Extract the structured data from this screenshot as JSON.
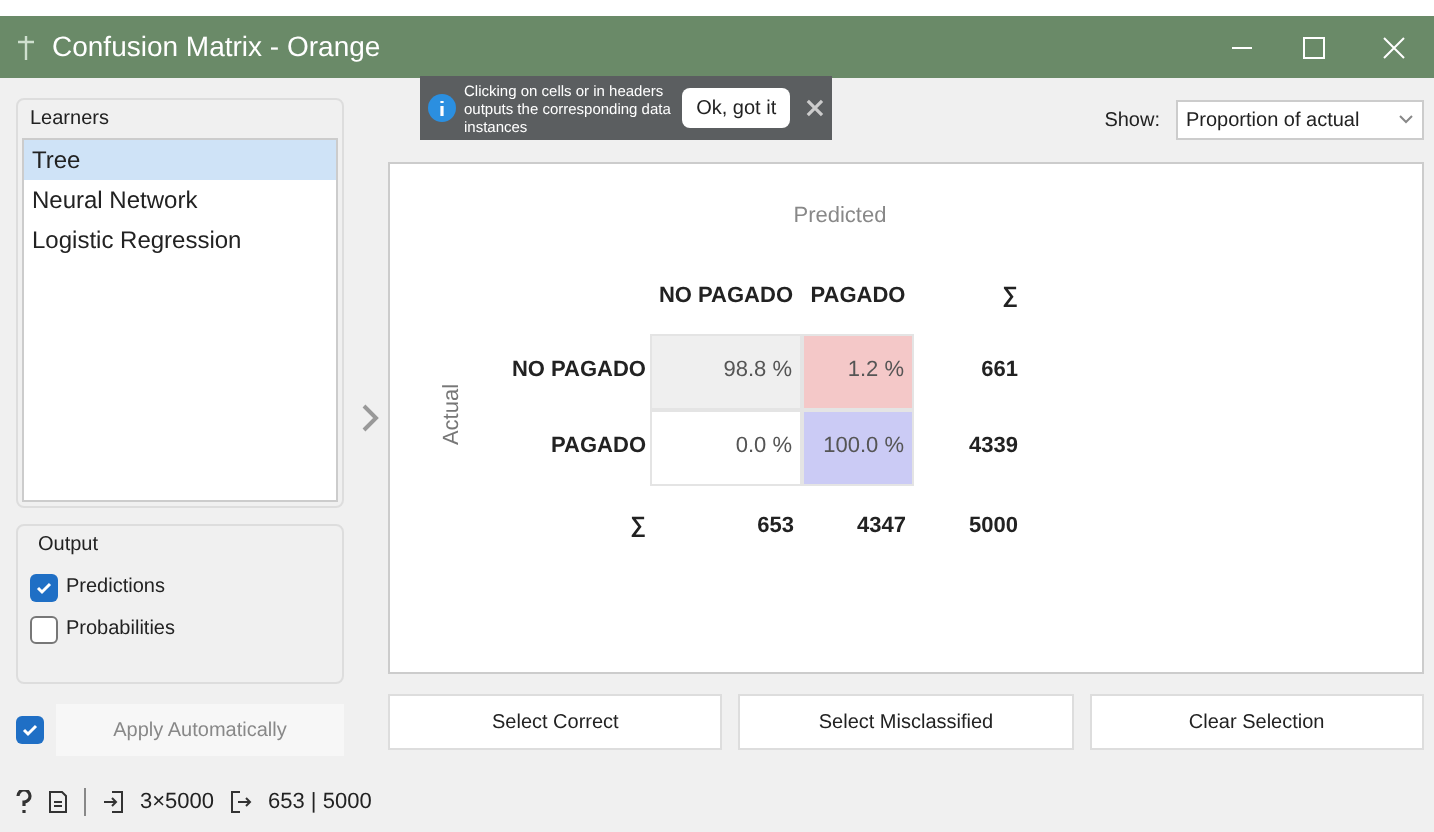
{
  "window": {
    "title": "Confusion Matrix - Orange"
  },
  "notification": {
    "text": "Clicking on cells or in headers outputs the corresponding data instances",
    "button": "Ok, got it"
  },
  "show": {
    "label": "Show:",
    "value": "Proportion of actual"
  },
  "learners": {
    "title": "Learners",
    "items": [
      {
        "label": "Tree",
        "selected": true
      },
      {
        "label": "Neural Network",
        "selected": false
      },
      {
        "label": "Logistic Regression",
        "selected": false
      }
    ]
  },
  "output": {
    "title": "Output",
    "options": [
      {
        "label": "Predictions",
        "checked": true
      },
      {
        "label": "Probabilities",
        "checked": false
      }
    ]
  },
  "apply": {
    "label": "Apply Automatically",
    "checked": true
  },
  "matrix": {
    "predicted_label": "Predicted",
    "actual_label": "Actual",
    "columns": [
      "NO PAGADO",
      "PAGADO",
      "∑"
    ],
    "rows": [
      {
        "label": "NO PAGADO",
        "cells": [
          {
            "text": "98.8 %",
            "color": "#efefef"
          },
          {
            "text": "1.2 %",
            "color": "#f4c8c8"
          }
        ],
        "total": "661"
      },
      {
        "label": "PAGADO",
        "cells": [
          {
            "text": "0.0 %",
            "color": "#ffffff"
          },
          {
            "text": "100.0 %",
            "color": "#cbcbf5"
          }
        ],
        "total": "4339"
      }
    ],
    "totals": {
      "label": "∑",
      "values": [
        "653",
        "4347",
        "5000"
      ]
    }
  },
  "buttons": [
    "Select Correct",
    "Select Misclassified",
    "Clear Selection"
  ],
  "status_bar": {
    "input": "3×5000",
    "output": "653 | 5000"
  }
}
